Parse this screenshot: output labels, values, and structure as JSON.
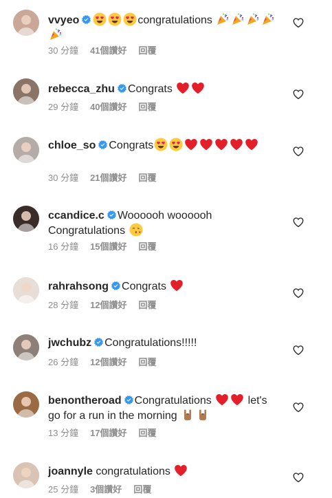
{
  "colors": {
    "text": "#262626",
    "secondary": "#8e8e8e",
    "verified": "#3897f0",
    "heart": "#ed1c24"
  },
  "comments": [
    {
      "username": "vvyeo",
      "verified": true,
      "segments": [
        {
          "emoji": "heart-eyes-emoji"
        },
        {
          "emoji": "heart-eyes-emoji"
        },
        {
          "emoji": "heart-eyes-emoji"
        },
        {
          "text": "congratulations "
        },
        {
          "emoji": "party-popper-emoji"
        },
        {
          "emoji": "party-popper-emoji"
        },
        {
          "emoji": "party-popper-emoji"
        },
        {
          "emoji": "party-popper-emoji"
        },
        {
          "emoji": "party-popper-emoji"
        }
      ],
      "time": "30 分鐘",
      "likes": "41個讚好",
      "reply": "回覆",
      "avatar_color": "#c9a89a"
    },
    {
      "username": "rebecca_zhu",
      "verified": true,
      "segments": [
        {
          "text": "Congrats "
        },
        {
          "emoji": "red-heart-emoji"
        },
        {
          "emoji": "red-heart-emoji"
        }
      ],
      "time": "29 分鐘",
      "likes": "40個讚好",
      "reply": "回覆",
      "avatar_color": "#8a7468"
    },
    {
      "username": "chloe_so",
      "verified": true,
      "segments": [
        {
          "text": "Congrats"
        },
        {
          "emoji": "heart-eyes-emoji"
        },
        {
          "emoji": "heart-eyes-emoji"
        },
        {
          "emoji": "red-heart-emoji"
        },
        {
          "emoji": "red-heart-emoji"
        },
        {
          "emoji": "red-heart-emoji"
        },
        {
          "emoji": "red-heart-emoji"
        },
        {
          "emoji": "red-heart-emoji"
        }
      ],
      "time": "30 分鐘",
      "likes": "21個讚好",
      "reply": "回覆",
      "avatar_color": "#b5aca8"
    },
    {
      "username": "ccandice.c",
      "verified": true,
      "segments": [
        {
          "text": "Woooooh woooooh Congratulations "
        },
        {
          "emoji": "kiss-emoji"
        }
      ],
      "time": "16 分鐘",
      "likes": "15個讚好",
      "reply": "回覆",
      "avatar_color": "#3a2c28"
    },
    {
      "username": "rahrahsong",
      "verified": true,
      "segments": [
        {
          "text": "Congrats "
        },
        {
          "emoji": "red-heart-emoji"
        }
      ],
      "time": "28 分鐘",
      "likes": "12個讚好",
      "reply": "回覆",
      "avatar_color": "#e8ded8"
    },
    {
      "username": "jwchubz",
      "verified": true,
      "segments": [
        {
          "text": "Congratulations!!!!!"
        }
      ],
      "time": "26 分鐘",
      "likes": "12個讚好",
      "reply": "回覆",
      "avatar_color": "#8c8079"
    },
    {
      "username": "benontheroad",
      "verified": true,
      "segments": [
        {
          "text": "Congratulations "
        },
        {
          "emoji": "red-heart-emoji"
        },
        {
          "emoji": "red-heart-emoji"
        },
        {
          "text": " let's go for a run in the morning "
        },
        {
          "emoji": "rock-hand-emoji"
        },
        {
          "emoji": "rock-hand-emoji"
        }
      ],
      "time": "13 分鐘",
      "likes": "17個讚好",
      "reply": "回覆",
      "avatar_color": "#9a6a45"
    },
    {
      "username": "joannyle",
      "verified": false,
      "segments": [
        {
          "text": "congratulations "
        },
        {
          "emoji": "red-heart-emoji"
        }
      ],
      "time": "25 分鐘",
      "likes": "3個讚好",
      "reply": "回覆",
      "avatar_color": "#d8c3b4"
    }
  ]
}
